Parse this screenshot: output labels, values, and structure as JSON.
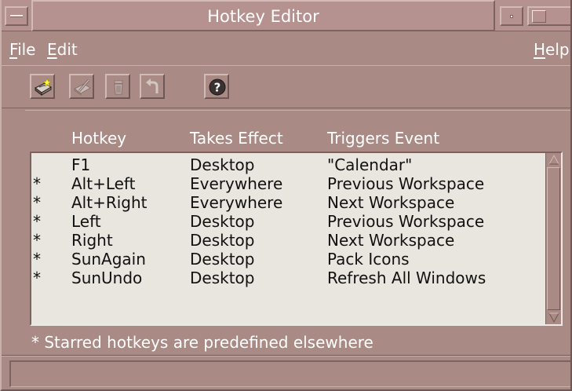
{
  "window": {
    "title": "Hotkey Editor"
  },
  "menubar": {
    "file": {
      "mnemonic": "F",
      "rest": "ile"
    },
    "edit": {
      "mnemonic": "E",
      "rest": "dit"
    },
    "help": {
      "mnemonic": "H",
      "rest": "elp"
    }
  },
  "toolbar": {
    "buttons": [
      {
        "icon": "new-hotkey-icon",
        "enabled": true
      },
      {
        "icon": "modify-hotkey-icon",
        "enabled": false
      },
      {
        "icon": "delete-hotkey-icon",
        "enabled": false
      },
      {
        "icon": "undo-icon",
        "enabled": false
      },
      {
        "icon": "help-icon",
        "enabled": true
      }
    ],
    "help_glyph": "?"
  },
  "columns": {
    "hotkey": "Hotkey",
    "takes_effect": "Takes Effect",
    "triggers_event": "Triggers Event"
  },
  "rows": [
    {
      "star": "",
      "hotkey": "F1",
      "takes_effect": "Desktop",
      "triggers_event": "\"Calendar\""
    },
    {
      "star": "*",
      "hotkey": "Alt+Left",
      "takes_effect": "Everywhere",
      "triggers_event": "Previous Workspace"
    },
    {
      "star": "*",
      "hotkey": "Alt+Right",
      "takes_effect": "Everywhere",
      "triggers_event": "Next Workspace"
    },
    {
      "star": "*",
      "hotkey": "Left",
      "takes_effect": "Desktop",
      "triggers_event": "Previous Workspace"
    },
    {
      "star": "*",
      "hotkey": "Right",
      "takes_effect": "Desktop",
      "triggers_event": "Next Workspace"
    },
    {
      "star": "*",
      "hotkey": "SunAgain",
      "takes_effect": "Desktop",
      "triggers_event": "Pack Icons"
    },
    {
      "star": "*",
      "hotkey": "SunUndo",
      "takes_effect": "Desktop",
      "triggers_event": "Refresh All Windows"
    }
  ],
  "footnote": "* Starred hotkeys are predefined elsewhere",
  "status": "",
  "colors": {
    "frame": "#a98a84",
    "titlebar": "#b59290",
    "list_bg": "#e8e6df",
    "text_light": "#ffffff"
  }
}
